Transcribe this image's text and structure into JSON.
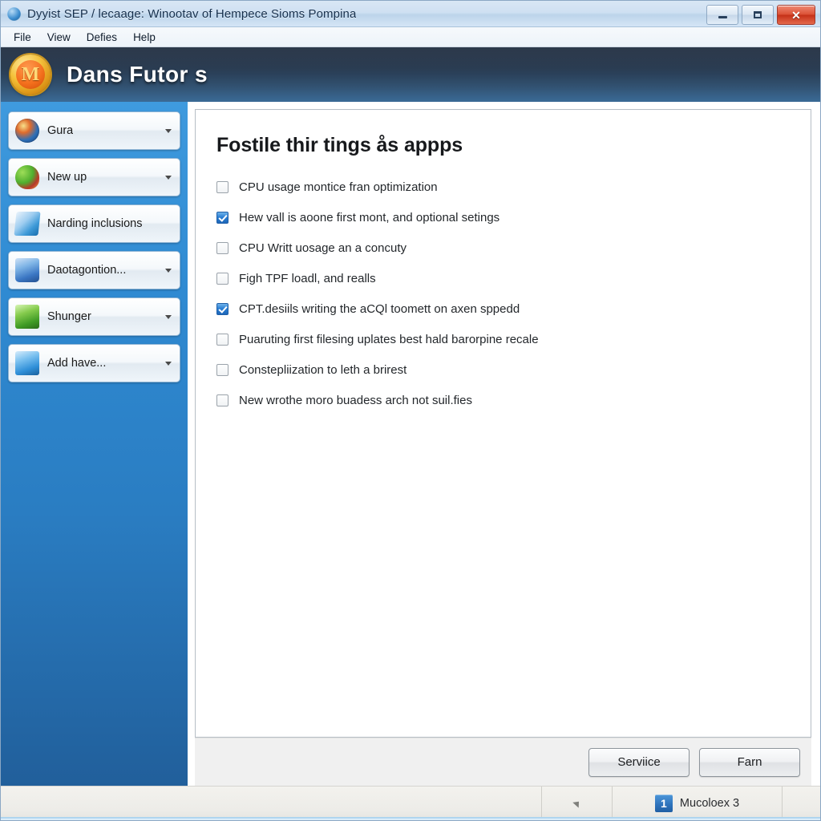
{
  "window": {
    "title": "Dyyist SEP / lecaage: Winootav of Hempece Sioms Pompina",
    "icon": "window-globe-icon",
    "controls": {
      "minimize": "minimize-button",
      "maximize": "maximize-button",
      "close_label": "✕"
    }
  },
  "menubar": {
    "items": [
      {
        "label": "File"
      },
      {
        "label": "View"
      },
      {
        "label": "Defies"
      },
      {
        "label": "Help"
      }
    ]
  },
  "appheader": {
    "logo_letter": "M",
    "title": "Dans Futor s"
  },
  "sidebar": {
    "items": [
      {
        "label": "Gura",
        "icon": "globe-icon",
        "has_caret": true
      },
      {
        "label": "New up",
        "icon": "paint-icon",
        "has_caret": true
      },
      {
        "label": "Narding inclusions",
        "icon": "pen-icon",
        "has_caret": false
      },
      {
        "label": "Daotagontion...",
        "icon": "book-icon",
        "has_caret": true
      },
      {
        "label": "Shunger",
        "icon": "green-icon",
        "has_caret": true
      },
      {
        "label": "Add have...",
        "icon": "blue5-icon",
        "has_caret": true
      }
    ]
  },
  "panel": {
    "heading": "Fostile thir tings ås appps",
    "options": [
      {
        "label": "CPU usage montice fran optimization",
        "checked": false
      },
      {
        "label": "Hew vall is aoone first mont, and optional setings",
        "checked": true
      },
      {
        "label": "CPU Writt uosage an a concuty",
        "checked": false
      },
      {
        "label": "Figh TPF loadl, and realls",
        "checked": false
      },
      {
        "label": "CPT.desiils writing the aCQl toomett on axen sppedd",
        "checked": true
      },
      {
        "label": "Puaruting first filesing uplates best hald barorpine recale",
        "checked": false
      },
      {
        "label": "Constepliization to leth a brirest",
        "checked": false
      },
      {
        "label": "New wrothe moro buadess arch not suil.fies",
        "checked": false
      }
    ]
  },
  "footer": {
    "buttons": [
      {
        "label": "Serviice"
      },
      {
        "label": "Farn"
      }
    ]
  },
  "statusbar": {
    "arrow_icon": "up-arrow-icon",
    "product_badge": "1",
    "product_name": "Mucoloex 3"
  },
  "colors": {
    "accent_blue": "#2f8ad2",
    "header_navy": "#27394f",
    "checkbox_checked": "#2b7fd4",
    "close_red": "#c53017",
    "logo_gold": "#f4bf36"
  }
}
